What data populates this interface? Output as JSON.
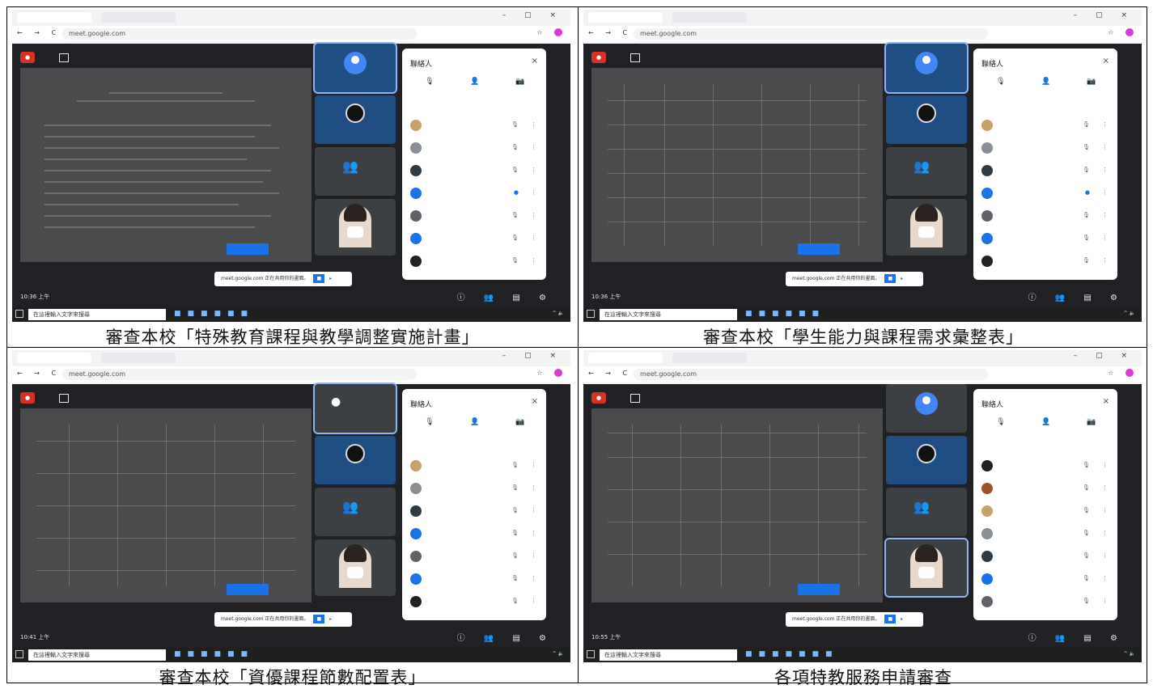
{
  "panels": [
    {
      "caption": "審查本校「特殊教育課程與教學調整實施計畫」",
      "time": "10:36 上午",
      "doc_style": "text"
    },
    {
      "caption": "審查本校「學生能力與課程需求彙整表」",
      "time": "10:36 上午",
      "doc_style": "table"
    },
    {
      "caption": "審查本校「資優課程節數配置表」",
      "time": "10:41 上午",
      "doc_style": "table"
    },
    {
      "caption": "各項特教服務申請審查",
      "time": "10:55 上午",
      "doc_style": "table"
    }
  ],
  "browser": {
    "url": "meet.google.com",
    "nav_icons": "← → C",
    "window_controls": "– ▢ ×"
  },
  "meet": {
    "panel_title": "聯絡人",
    "close_icon": "×",
    "toast_text": "meet.google.com 正在共用你的畫面。",
    "taskbar_search": "在這裡輸入文字來搜尋"
  },
  "colors": {
    "meet_background": "#202124",
    "rec_red": "#d93025",
    "accent_blue": "#1a73e8"
  }
}
